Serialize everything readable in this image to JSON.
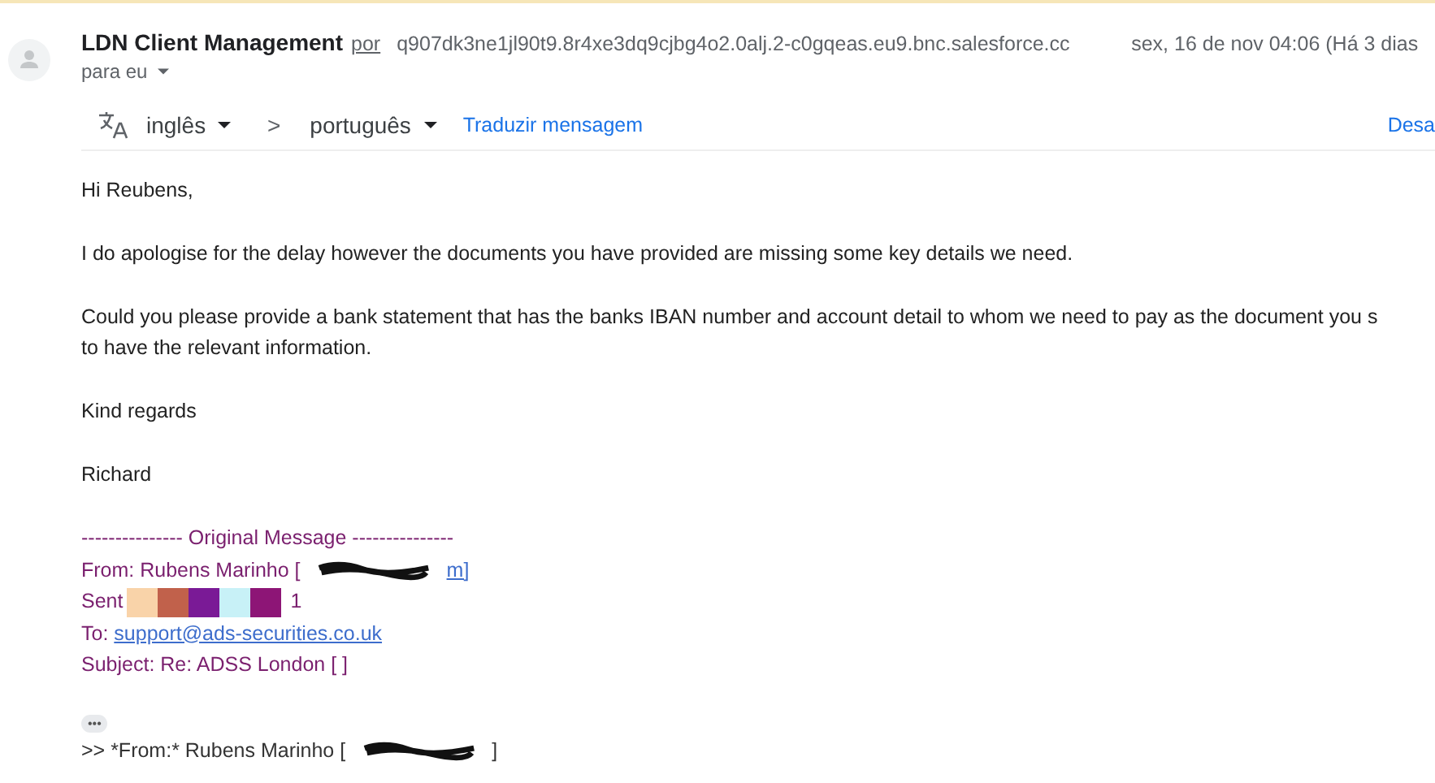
{
  "header": {
    "sender": "LDN Client Management",
    "via": "por",
    "address": "q907dk3ne1jl90t9.8r4xe3dq9cjbg4o2.0alj.2-c0gqeas.eu9.bnc.salesforce.cc",
    "date": "sex, 16 de nov 04:06 (Há 3 dias",
    "recipient": "para eu"
  },
  "translate_bar": {
    "source_language": "inglês",
    "separator": ">",
    "target_language": "português",
    "translate_link": "Traduzir mensagem",
    "right_link": "Desa"
  },
  "body": [
    "Hi Reubens,",
    "I do apologise for the delay however the documents you have provided are missing some key details we need.",
    "Could you please provide a bank statement that has the banks IBAN number and account detail to whom we need to pay as the document you s\nto have the relevant information.",
    "Kind regards",
    "Richard"
  ],
  "original_message": {
    "divider": "--------------- Original Message ---------------",
    "from_label": "From: Rubens Marinho [",
    "from_end": "m]",
    "sent_label": "Sent",
    "sent_end": "1",
    "to_label": "To:",
    "to_address": "support@ads-securities.co.uk",
    "subject": "Subject: Re: ADSS London [ ]"
  },
  "expand_button": "•••",
  "quoted": {
    "from_text": ">> *From:* Rubens Marinho [",
    "from_end": "]"
  }
}
